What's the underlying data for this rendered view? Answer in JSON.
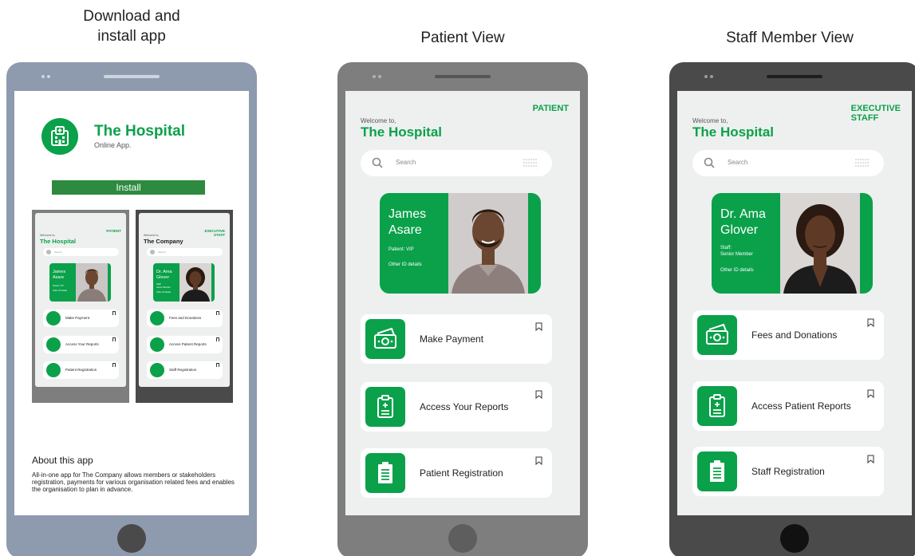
{
  "captions": {
    "left": [
      "Download and",
      "install app"
    ],
    "middle": "Patient View",
    "right": "Staff Member View"
  },
  "colors": {
    "brand_green": "#0aa14a",
    "install_button": "#2d8a3e",
    "screen_bg": "#eef0ef",
    "phone_left": "#8e9aad",
    "phone_middle": "#7e7e7e",
    "phone_right": "#4a4a4a"
  },
  "install_screen": {
    "app_name": "The Hospital",
    "app_subtitle": "Online App.",
    "install_label": "Install",
    "about_heading": "About this app",
    "about_text": "All-in-one app for The Company allows members or stakeholders registration, payments for various organisation related fees and enables the organisation to plan in advance.",
    "preview_patient": {
      "role": "PATIENT",
      "welcome": "Welcome to,",
      "title": "The Hospital",
      "search_placeholder": "Search",
      "name": [
        "James",
        "Asare"
      ],
      "meta": [
        "Patient: VIP",
        "Other ID details"
      ],
      "tiles": [
        "Make Payment",
        "Access Your Reports",
        "Patient Registration"
      ]
    },
    "preview_staff": {
      "role": [
        "EXECUTIVE",
        "STAFF"
      ],
      "welcome": "Welcome to,",
      "title": "The Company",
      "search_placeholder": "Search",
      "name": [
        "Dr. Ama",
        "Glover"
      ],
      "meta": [
        "Staff:",
        "Senior Member",
        "Other ID details"
      ],
      "tiles": [
        "Fees and Donations",
        "Access Patient Reports",
        "Staff Registration"
      ]
    }
  },
  "patient_screen": {
    "role": "PATIENT",
    "welcome": "Welcome to,",
    "title": "The Hospital",
    "search_placeholder": "Search",
    "card": {
      "name_line1": "James",
      "name_line2": "Asare",
      "meta1": "Patient: VIP",
      "meta2": "Other ID details"
    },
    "tiles": [
      {
        "label": "Make Payment",
        "icon": "money-icon"
      },
      {
        "label": "Access Your Reports",
        "icon": "clipboard-report-icon"
      },
      {
        "label": "Patient Registration",
        "icon": "registration-form-icon"
      }
    ]
  },
  "staff_screen": {
    "role_line1": "EXECUTIVE",
    "role_line2": "STAFF",
    "welcome": "Welcome to,",
    "title": "The Hospital",
    "search_placeholder": "Search",
    "card": {
      "name_line1": "Dr. Ama",
      "name_line2": "Glover",
      "meta1": "Staff:",
      "meta2": "Senior Member",
      "meta3": "Other ID details"
    },
    "tiles": [
      {
        "label": "Fees and Donations",
        "icon": "money-icon"
      },
      {
        "label": "Access Patient Reports",
        "icon": "clipboard-report-icon"
      },
      {
        "label": "Staff Registration",
        "icon": "registration-form-icon"
      }
    ]
  }
}
